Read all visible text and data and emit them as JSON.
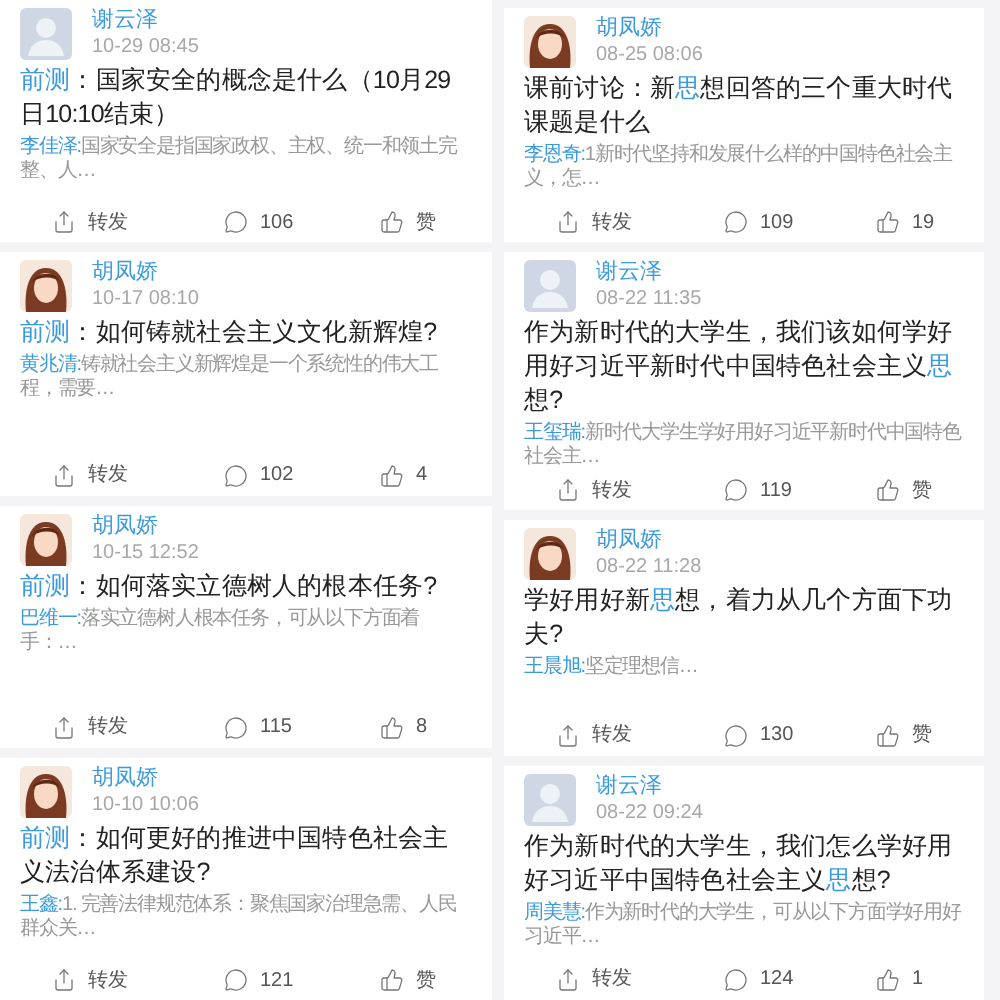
{
  "columns": [
    {
      "posts": [
        {
          "author": "谢云泽",
          "avatar": {
            "kind": "placeholder"
          },
          "time": "10-29 08:45",
          "title": [
            {
              "text": "前测",
              "highlight": true
            },
            {
              "text": "：国家安全的概念是什么（10月29日10:10结束）",
              "highlight": false
            }
          ],
          "reply": {
            "author": "李佳泽:",
            "text": "国家安全是指国家政权、主权、统一和领土完整、人…"
          },
          "actions": {
            "share": "转发",
            "comments": "106",
            "likes": "赞"
          }
        },
        {
          "author": "胡凤娇",
          "avatar": {
            "kind": "cartoon"
          },
          "time": "10-17 08:10",
          "title": [
            {
              "text": "前测",
              "highlight": true
            },
            {
              "text": "：如何铸就社会主义文化新辉煌?",
              "highlight": false
            }
          ],
          "reply": {
            "author": "黄兆清:",
            "text": "铸就社会主义新辉煌是一个系统性的伟大工程，需要…"
          },
          "actions": {
            "share": "转发",
            "comments": "102",
            "likes": "4"
          }
        },
        {
          "author": "胡凤娇",
          "avatar": {
            "kind": "cartoon"
          },
          "time": "10-15 12:52",
          "title": [
            {
              "text": "前测",
              "highlight": true
            },
            {
              "text": "：如何落实立德树人的根本任务?",
              "highlight": false
            }
          ],
          "reply": {
            "author": "巴维一:",
            "text": "落实立德树人根本任务，可从以下方面着手：…"
          },
          "actions": {
            "share": "转发",
            "comments": "115",
            "likes": "8"
          }
        },
        {
          "author": "胡凤娇",
          "avatar": {
            "kind": "cartoon"
          },
          "time": "10-10 10:06",
          "title": [
            {
              "text": "前测",
              "highlight": true
            },
            {
              "text": "：如何更好的推进中国特色社会主义法治体系建设?",
              "highlight": false
            }
          ],
          "reply": {
            "author": "王鑫:",
            "text": "1. 完善法律规范体系：聚焦国家治理急需、人民群众关…"
          },
          "actions": {
            "share": "转发",
            "comments": "121",
            "likes": "赞"
          }
        }
      ]
    },
    {
      "posts": [
        {
          "author": "胡凤娇",
          "avatar": {
            "kind": "cartoon"
          },
          "time": "08-25 08:06",
          "title": [
            {
              "text": "课前讨论：新",
              "highlight": false
            },
            {
              "text": "思",
              "highlight": true
            },
            {
              "text": "想回答的三个重大时代课题是什么",
              "highlight": false
            }
          ],
          "reply": {
            "author": "李恩奇:",
            "text": "1新时代坚持和发展什么样的中国特色社会主义，怎…"
          },
          "actions": {
            "share": "转发",
            "comments": "109",
            "likes": "19"
          }
        },
        {
          "author": "谢云泽",
          "avatar": {
            "kind": "placeholder"
          },
          "time": "08-22 11:35",
          "title": [
            {
              "text": "作为新时代的大学生，我们该如何学好用好习近平新时代中国特色社会主义",
              "highlight": false
            },
            {
              "text": "思",
              "highlight": true
            },
            {
              "text": "想?",
              "highlight": false
            }
          ],
          "reply": {
            "author": "王玺瑞:",
            "text": "新时代大学生学好用好习近平新时代中国特色社会主…"
          },
          "actions": {
            "share": "转发",
            "comments": "119",
            "likes": "赞"
          }
        },
        {
          "author": "胡凤娇",
          "avatar": {
            "kind": "cartoon"
          },
          "time": "08-22 11:28",
          "title": [
            {
              "text": "学好用好新",
              "highlight": false
            },
            {
              "text": "思",
              "highlight": true
            },
            {
              "text": "想，着力从几个方面下功夫?",
              "highlight": false
            }
          ],
          "reply": {
            "author": "王晨旭:",
            "text": "坚定理想信…"
          },
          "actions": {
            "share": "转发",
            "comments": "130",
            "likes": "赞"
          }
        },
        {
          "author": "谢云泽",
          "avatar": {
            "kind": "placeholder"
          },
          "time": "08-22 09:24",
          "title": [
            {
              "text": "作为新时代的大学生，我们怎么学好用好习近平中国特色社会主义",
              "highlight": false
            },
            {
              "text": "思",
              "highlight": true
            },
            {
              "text": "想?",
              "highlight": false
            }
          ],
          "reply": {
            "author": "周美慧:",
            "text": "作为新时代的大学生，可从以下方面学好用好习近平…"
          },
          "actions": {
            "share": "转发",
            "comments": "124",
            "likes": "1"
          }
        }
      ]
    }
  ]
}
